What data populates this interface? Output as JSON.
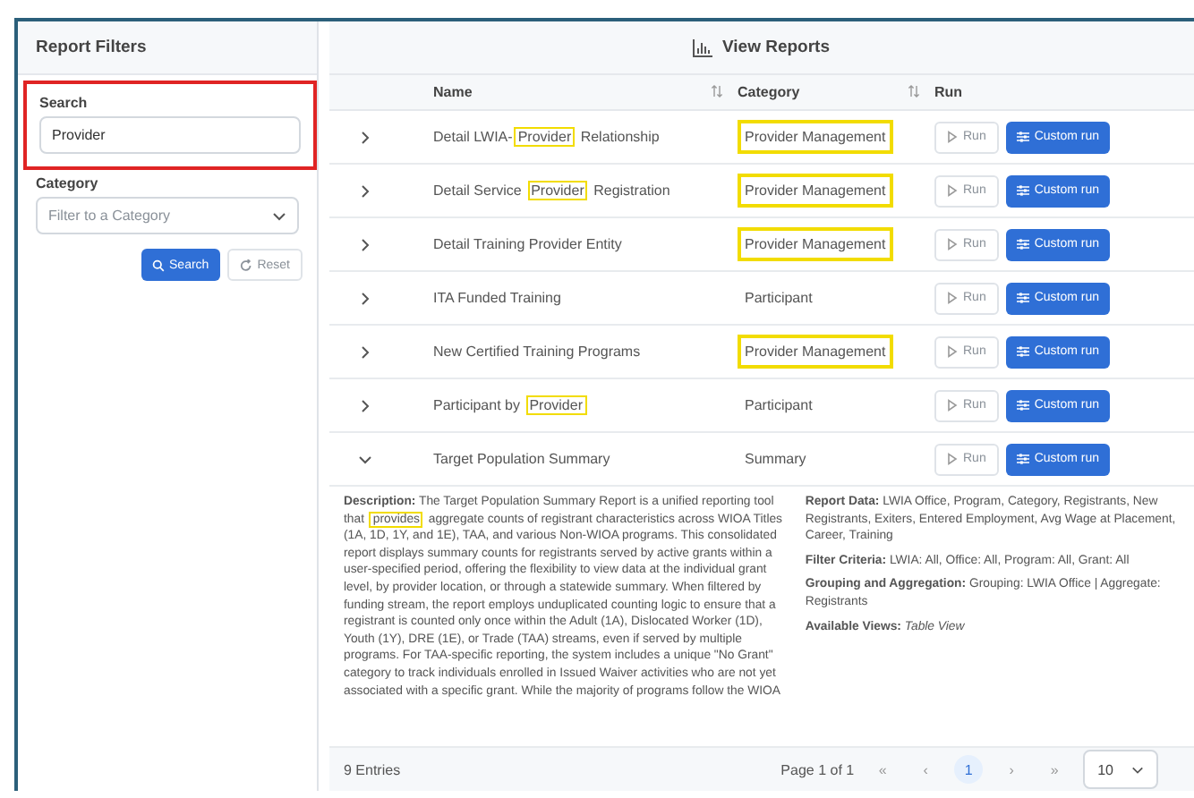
{
  "filters": {
    "title": "Report Filters",
    "search": {
      "label": "Search",
      "value": "Provider",
      "highlighted": true
    },
    "category": {
      "label": "Category",
      "placeholder": "Filter to a Category"
    },
    "search_button": "Search",
    "reset_button": "Reset"
  },
  "reports": {
    "title": "View Reports",
    "columns": [
      {
        "label": "Name",
        "sortable": true
      },
      {
        "label": "Category",
        "sortable": true
      },
      {
        "label": "Run",
        "sortable": false
      }
    ],
    "rows": [
      {
        "name": [
          {
            "text": "Detail LWIA-"
          },
          {
            "text": "Provider",
            "highlighted": true
          },
          {
            "text": " Relationship"
          }
        ],
        "category": "Provider Management",
        "category_highlighted": true,
        "expanded": false,
        "run": "Run",
        "custom_run": "Custom run"
      },
      {
        "name": [
          {
            "text": "Detail Service "
          },
          {
            "text": "Provider",
            "highlighted": true
          },
          {
            "text": " Registration"
          }
        ],
        "category": "Provider Management",
        "category_highlighted": true,
        "expanded": false,
        "run": "Run",
        "custom_run": "Custom run"
      },
      {
        "name": [
          {
            "text": "Detail Training Provider Entity"
          }
        ],
        "category": "Provider Management",
        "category_highlighted": true,
        "expanded": false,
        "run": "Run",
        "custom_run": "Custom run"
      },
      {
        "name": [
          {
            "text": "ITA Funded Training"
          }
        ],
        "category": "Participant",
        "category_highlighted": false,
        "expanded": false,
        "run": "Run",
        "custom_run": "Custom run"
      },
      {
        "name": [
          {
            "text": "New Certified Training Programs"
          }
        ],
        "category": "Provider Management",
        "category_highlighted": true,
        "expanded": false,
        "run": "Run",
        "custom_run": "Custom run"
      },
      {
        "name": [
          {
            "text": "Participant by "
          },
          {
            "text": "Provider",
            "highlighted": true
          }
        ],
        "category": "Participant",
        "category_highlighted": false,
        "expanded": false,
        "run": "Run",
        "custom_run": "Custom run"
      },
      {
        "name": [
          {
            "text": "Target Population Summary"
          }
        ],
        "category": "Summary",
        "category_highlighted": false,
        "expanded": true,
        "run": "Run",
        "custom_run": "Custom run"
      }
    ],
    "details": {
      "description": {
        "label": "Description:",
        "segments": [
          {
            "text": "The Target Population Summary Report is a unified reporting tool that "
          },
          {
            "text": "provides",
            "highlighted": true
          },
          {
            "text": " aggregate counts of registrant characteristics across WIOA Titles (1A, 1D, 1Y, and 1E), TAA, and various Non-WIOA programs. This consolidated report displays summary counts for registrants served by active grants within a user-specified period, offering the flexibility to view data at the individual grant level, by provider location, or through a statewide summary. When filtered by funding stream, the report employs unduplicated counting logic to ensure that a registrant is counted only once within the Adult (1A), Dislocated Worker (1D), Youth (1Y), DRE (1E), or Trade (TAA) streams, even if served by multiple programs. For TAA-specific reporting, the system includes a unique \"No Grant\" category to track individuals enrolled in Issued Waiver activities who are not yet associated with a specific grant. While the majority of programs follow the WIOA"
          }
        ]
      },
      "facts": [
        {
          "label": "Report Data:",
          "value": "LWIA Office, Program, Category, Registrants, New Registrants, Exiters, Entered Employment, Avg Wage at Placement, Career, Training",
          "italic": false
        },
        {
          "label": "Filter Criteria:",
          "value": "LWIA: All, Office: All, Program: All, Grant: All",
          "italic": false
        },
        {
          "label": "Grouping and Aggregation:",
          "value": "Grouping: LWIA Office | Aggregate: Registrants",
          "italic": false
        },
        {
          "label": "Available Views:",
          "value": "Table View",
          "italic": true
        }
      ]
    },
    "footer": {
      "entries": "9 Entries",
      "page_info": "Page 1 of 1",
      "first": "«",
      "prev": "‹",
      "pages": [
        {
          "label": "1",
          "selected": true
        }
      ],
      "next": "›",
      "last": "»",
      "page_size": "10"
    }
  }
}
